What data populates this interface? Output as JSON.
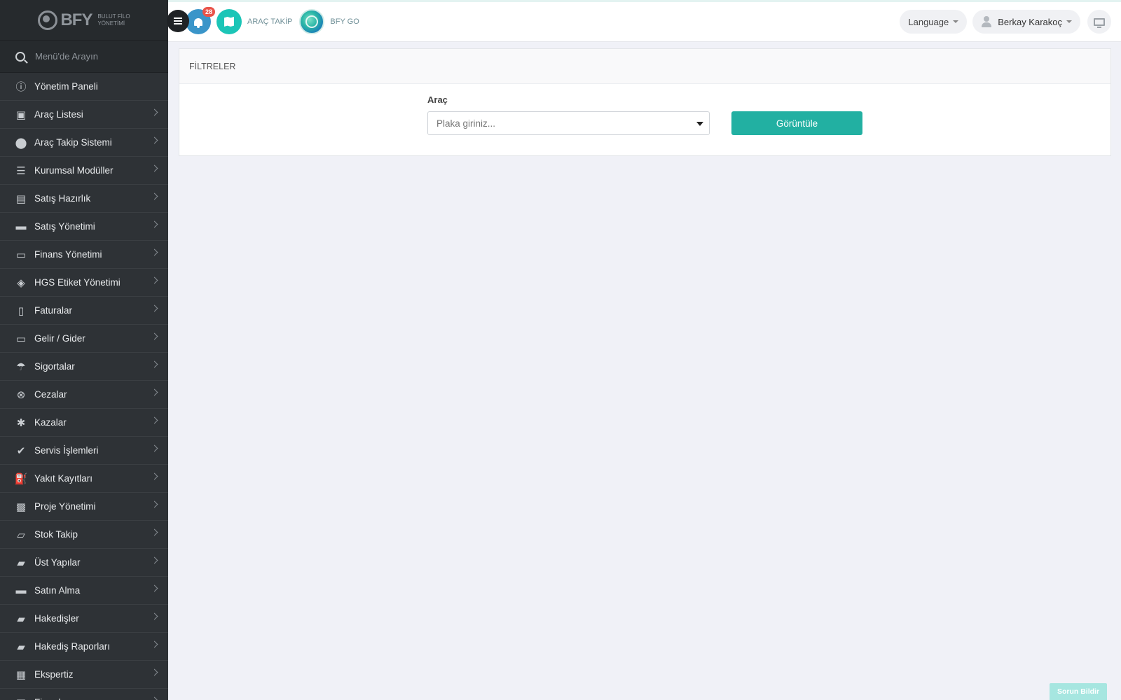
{
  "brand": {
    "name": "BFY",
    "subtitle_line1": "BULUT FİLO",
    "subtitle_line2": "YÖNETİMİ"
  },
  "sidebar": {
    "search_placeholder": "Menü'de Arayın",
    "items": [
      {
        "label": "Yönetim Paneli",
        "icon": "dashboard-icon",
        "glyph": "ⓘ",
        "has_chevron": false
      },
      {
        "label": "Araç Listesi",
        "icon": "bus-icon",
        "glyph": "▣",
        "has_chevron": true
      },
      {
        "label": "Araç Takip Sistemi",
        "icon": "map-pin-icon",
        "glyph": "⬤",
        "has_chevron": true
      },
      {
        "label": "Kurumsal Modüller",
        "icon": "server-icon",
        "glyph": "☰",
        "has_chevron": true
      },
      {
        "label": "Satış Hazırlık",
        "icon": "book-icon",
        "glyph": "▤",
        "has_chevron": true
      },
      {
        "label": "Satış Yönetimi",
        "icon": "credit-card-icon",
        "glyph": "▬",
        "has_chevron": true
      },
      {
        "label": "Finans Yönetimi",
        "icon": "money-icon",
        "glyph": "▭",
        "has_chevron": true
      },
      {
        "label": "HGS Etiket Yönetimi",
        "icon": "ticket-icon",
        "glyph": "◈",
        "has_chevron": true
      },
      {
        "label": "Faturalar",
        "icon": "file-icon",
        "glyph": "▯",
        "has_chevron": true
      },
      {
        "label": "Gelir / Gider",
        "icon": "money-icon",
        "glyph": "▭",
        "has_chevron": true
      },
      {
        "label": "Sigortalar",
        "icon": "umbrella-icon",
        "glyph": "☂",
        "has_chevron": true
      },
      {
        "label": "Cezalar",
        "icon": "times-circle-icon",
        "glyph": "⊗",
        "has_chevron": true
      },
      {
        "label": "Kazalar",
        "icon": "car-crash-icon",
        "glyph": "✱",
        "has_chevron": true
      },
      {
        "label": "Servis İşlemleri",
        "icon": "check-circle-icon",
        "glyph": "✔",
        "has_chevron": true
      },
      {
        "label": "Yakıt Kayıtları",
        "icon": "gas-pump-icon",
        "glyph": "⛽",
        "has_chevron": true
      },
      {
        "label": "Proje Yönetimi",
        "icon": "briefcase-icon",
        "glyph": "▩",
        "has_chevron": true
      },
      {
        "label": "Stok Takip",
        "icon": "inbox-icon",
        "glyph": "▱",
        "has_chevron": true
      },
      {
        "label": "Üst Yapılar",
        "icon": "truck-icon",
        "glyph": "▰",
        "has_chevron": true
      },
      {
        "label": "Satın Alma",
        "icon": "credit-card-icon",
        "glyph": "▬",
        "has_chevron": true
      },
      {
        "label": "Hakedişler",
        "icon": "truck-icon",
        "glyph": "▰",
        "has_chevron": true
      },
      {
        "label": "Hakediş Raporları",
        "icon": "truck-icon",
        "glyph": "▰",
        "has_chevron": true
      },
      {
        "label": "Ekspertiz",
        "icon": "list-alt-icon",
        "glyph": "▦",
        "has_chevron": true
      },
      {
        "label": "Firmalar",
        "icon": "building-icon",
        "glyph": "▦",
        "has_chevron": true
      }
    ]
  },
  "topbar": {
    "notification_count": "28",
    "arac_takip_label": "ARAÇ TAKİP",
    "bfy_go_label": "BFY GO",
    "language_label": "Language",
    "user_name": "Berkay Karakoç"
  },
  "filters": {
    "title": "FİLTRELER",
    "vehicle_label": "Araç",
    "vehicle_placeholder": "Plaka giriniz...",
    "view_button": "Görüntüle"
  },
  "report_issue": "Sorun Bildir",
  "colors": {
    "accent": "#22b0a2",
    "sidebar": "#2e3236",
    "badge": "#e9544a"
  }
}
